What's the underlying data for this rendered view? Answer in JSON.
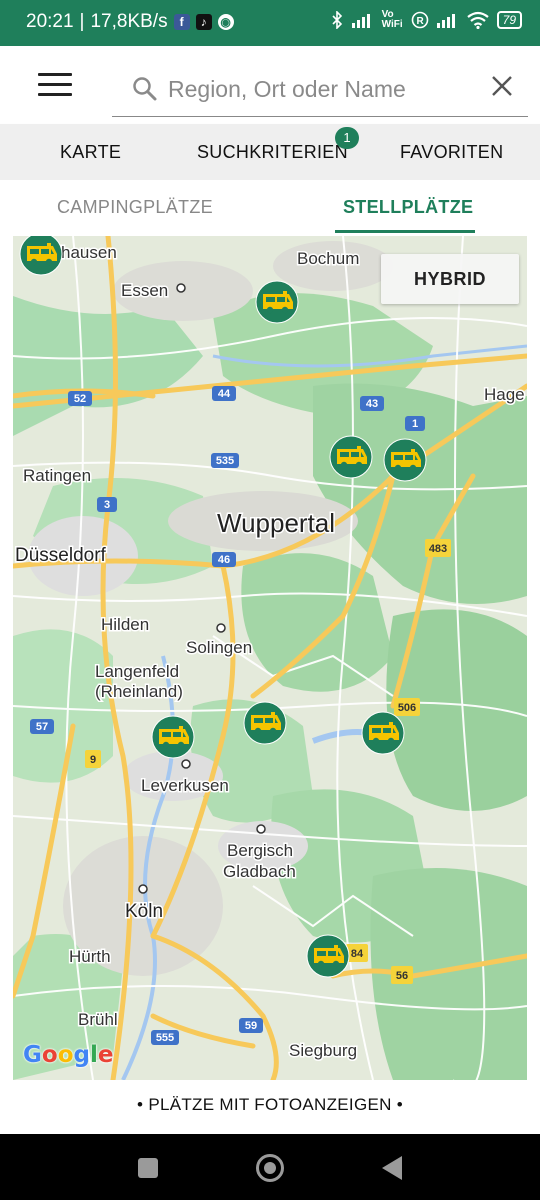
{
  "status_bar": {
    "time": "20:21",
    "network_speed": "17,8KB/s",
    "battery": "79",
    "right_icons": [
      "bluetooth-icon",
      "signal-icon",
      "volte-icon",
      "roaming-icon",
      "signal-icon",
      "wifi-icon",
      "battery-icon"
    ]
  },
  "header": {
    "search_placeholder": "Region, Ort oder Name",
    "search_value": ""
  },
  "main_tabs": {
    "karte": "KARTE",
    "suchkriterien": "SUCHKRITERIEN",
    "suchkriterien_badge": "1",
    "favoriten": "FAVORITEN"
  },
  "sub_tabs": {
    "campingplaetze": "CAMPINGPLÄTZE",
    "stellplaetze": "STELLPLÄTZE",
    "active": "stellplaetze"
  },
  "map": {
    "hybrid_button": "HYBRID",
    "attribution": "Google",
    "places": {
      "essen": "Essen",
      "bochum": "Bochum",
      "hausen": "hausen",
      "hage": "Hage",
      "ratingen": "Ratingen",
      "wuppertal": "Wuppertal",
      "duesseldorf": "Düsseldorf",
      "hilden": "Hilden",
      "solingen": "Solingen",
      "langenfeld_1": "Langenfeld",
      "langenfeld_2": "(Rheinland)",
      "leverkusen": "Leverkusen",
      "bergisch_1": "Bergisch",
      "bergisch_2": "Gladbach",
      "koeln": "Köln",
      "huerth": "Hürth",
      "bruehl": "Brühl",
      "siegburg": "Siegburg"
    },
    "road_labels": {
      "r52": "52",
      "r44": "44",
      "r43": "43",
      "r1": "1",
      "r535": "535",
      "r3": "3",
      "r46": "46",
      "r483": "483",
      "r506": "506",
      "r57": "57",
      "r9": "9",
      "r555": "555",
      "r59": "59",
      "r56": "56",
      "r84": "84"
    },
    "marker_icon": "campervan-icon",
    "colors": {
      "marker": "#1f7f5b",
      "van": "#f5c400",
      "forest": "#a8d8a8",
      "motorway": "#f7c95a"
    }
  },
  "footer": {
    "photo_ads_link": "• PLÄTZE MIT FOTOANZEIGEN •"
  },
  "nav": {
    "recents": "recents-icon",
    "home": "home-icon",
    "back": "back-icon"
  }
}
